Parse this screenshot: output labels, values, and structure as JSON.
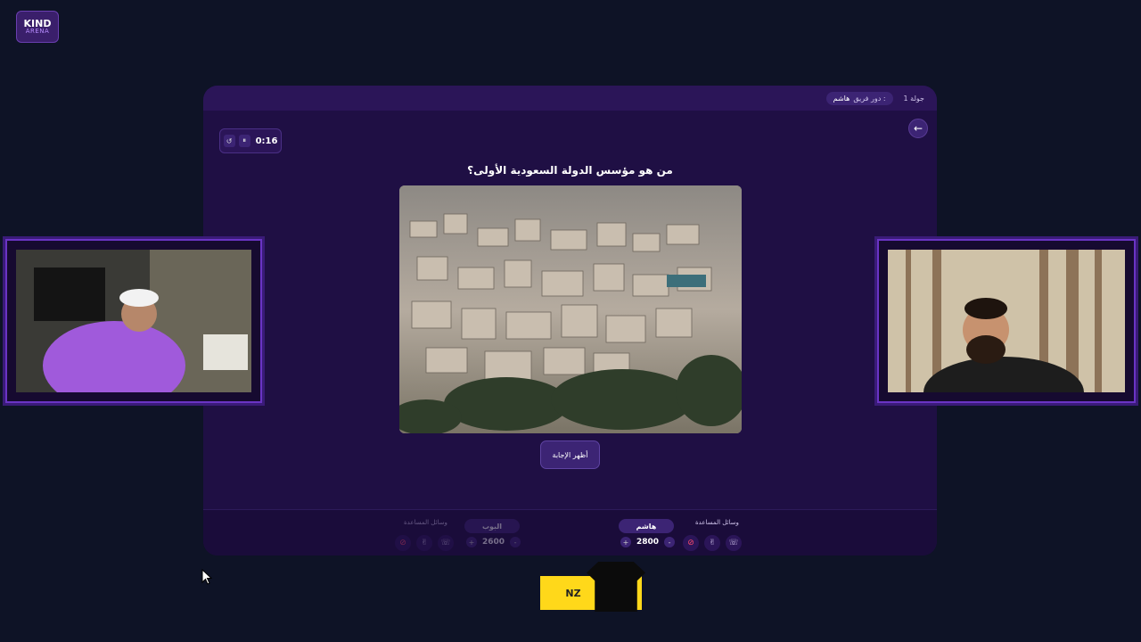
{
  "logo": {
    "line1": "KIND",
    "line2": "ARENA"
  },
  "topbar": {
    "round": "جولة 1",
    "turn_label": "دور فريق :",
    "turn_team": "هاشم"
  },
  "timer": {
    "time": "0:16",
    "reset_glyph": "↺",
    "pause_glyph": "⏸"
  },
  "back": {
    "glyph": "←"
  },
  "question": {
    "text": "من هو مؤسس الدولة السعودية الأولى؟"
  },
  "show_answer_label": "أظهر الإجابة",
  "teams": [
    {
      "name": "هاشم",
      "score": "2800",
      "aids_label": "وسائل المساعدة",
      "plus": "+",
      "minus": "-"
    },
    {
      "name": "البوب",
      "score": "2600",
      "aids_label": "وسائل المساعدة",
      "plus": "+",
      "minus": "-"
    }
  ],
  "aid_icons": [
    "phone-icon",
    "hand-icon",
    "block-icon"
  ],
  "sponsor": {
    "text": "NZ"
  },
  "colors": {
    "bg": "#0e1326",
    "panel": "#1f0f44",
    "accent": "#6a34c4",
    "sponsor": "#ffd81a"
  }
}
